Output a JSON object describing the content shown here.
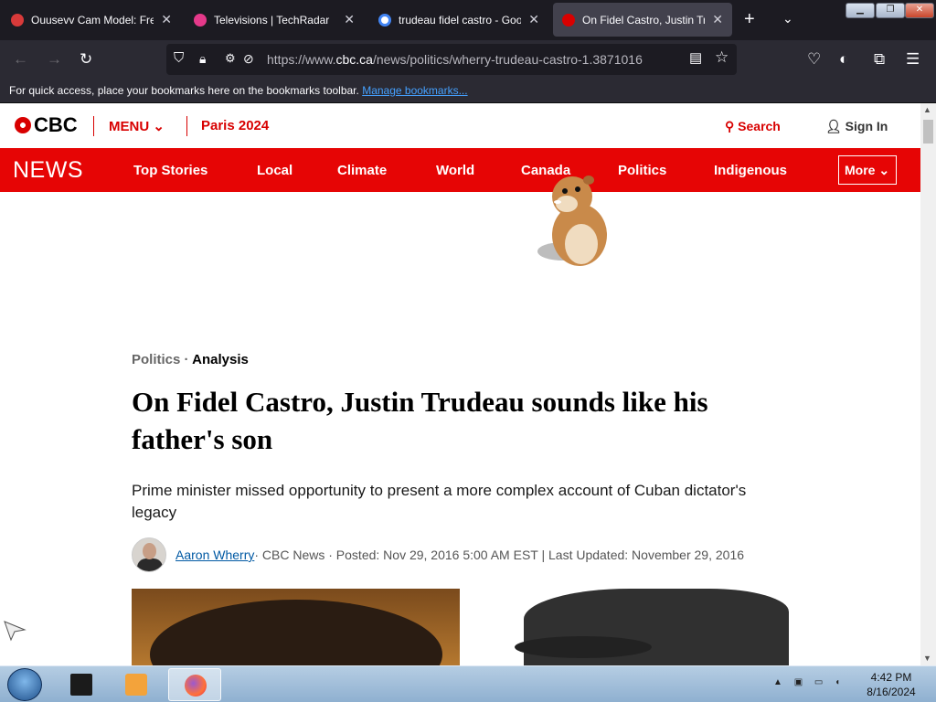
{
  "browser": {
    "tabs": [
      {
        "title": "Ouusevv Cam Model: Free",
        "favicon_color": "#d83a3a"
      },
      {
        "title": "Televisions | TechRadar",
        "favicon_color": "#e5398a"
      },
      {
        "title": "trudeau fidel castro - Google Search",
        "favicon_color": "#4285f4"
      },
      {
        "title": "On Fidel Castro, Justin Trudeau",
        "favicon_color": "#d80000"
      }
    ],
    "new_tab_icon": "+",
    "tab_list_icon": "⌄",
    "url_prefix": "https://www.",
    "url_domain": "cbc.ca",
    "url_path": "/news/politics/wherry-trudeau-castro-1.3871016",
    "bookmarks_text": "For quick access, place your bookmarks here on the bookmarks toolbar.",
    "bookmarks_link": "Manage bookmarks..."
  },
  "cbc": {
    "logo": "CBC",
    "menu_label": "MENU",
    "paris_label": "Paris 2024",
    "search_label": "Search",
    "signin_label": "Sign In",
    "news_logo": "NEWS",
    "nav_items": [
      "Top Stories",
      "Local",
      "Climate",
      "World",
      "Canada",
      "Politics",
      "Indigenous"
    ],
    "more_label": "More"
  },
  "article": {
    "section": "Politics",
    "separator": "·",
    "type": "Analysis",
    "headline": "On Fidel Castro, Justin Trudeau sounds like his father's son",
    "dek": "Prime minister missed opportunity to present a more complex account of Cuban dictator's legacy",
    "author": "Aaron Wherry",
    "byline_rest": " · CBC News · Posted: Nov 29, 2016 5:00 AM EST | Last Updated: November 29, 2016"
  },
  "taskbar": {
    "time": "4:42 PM",
    "date": "8/16/2024"
  },
  "colors": {
    "cbc_red": "#e60505",
    "link_blue": "#0059a3"
  }
}
